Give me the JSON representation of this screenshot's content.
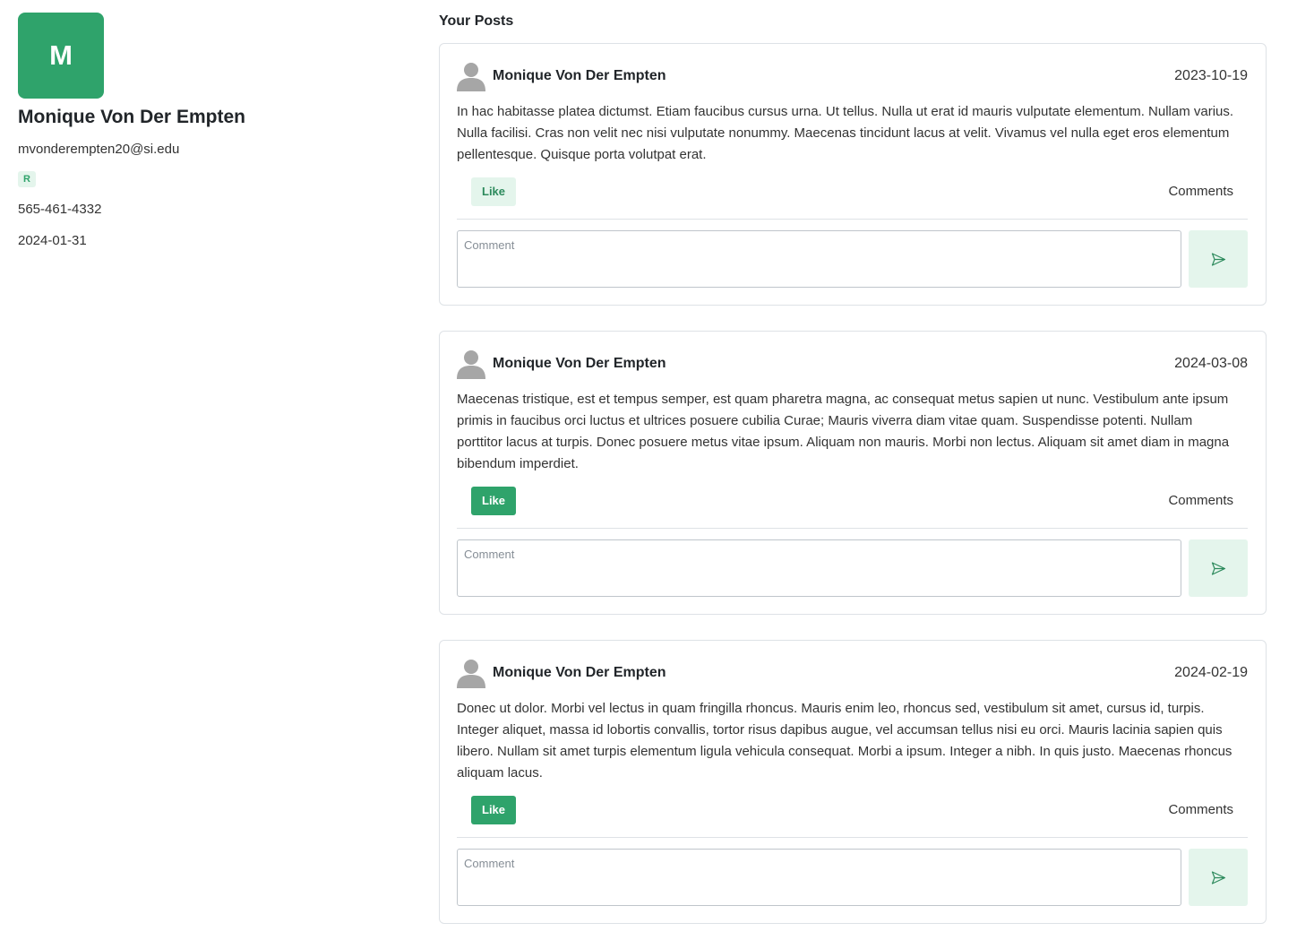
{
  "profile": {
    "avatar_letter": "M",
    "name": "Monique Von Der Empten",
    "email": "mvonderempten20@si.edu",
    "role_badge": "R",
    "phone": "565-461-4332",
    "date": "2024-01-31"
  },
  "posts_section": {
    "title": "Your Posts"
  },
  "posts": [
    {
      "author": "Monique Von Der Empten",
      "date": "2023-10-19",
      "body": "In hac habitasse platea dictumst. Etiam faucibus cursus urna. Ut tellus. Nulla ut erat id mauris vulputate elementum. Nullam varius. Nulla facilisi. Cras non velit nec nisi vulputate nonummy. Maecenas tincidunt lacus at velit. Vivamus vel nulla eget eros elementum pellentesque. Quisque porta volutpat erat.",
      "like_label": "Like",
      "liked": false,
      "comments_label": "Comments",
      "comment_placeholder": "Comment"
    },
    {
      "author": "Monique Von Der Empten",
      "date": "2024-03-08",
      "body": "Maecenas tristique, est et tempus semper, est quam pharetra magna, ac consequat metus sapien ut nunc. Vestibulum ante ipsum primis in faucibus orci luctus et ultrices posuere cubilia Curae; Mauris viverra diam vitae quam. Suspendisse potenti. Nullam porttitor lacus at turpis. Donec posuere metus vitae ipsum. Aliquam non mauris. Morbi non lectus. Aliquam sit amet diam in magna bibendum imperdiet.",
      "like_label": "Like",
      "liked": true,
      "comments_label": "Comments",
      "comment_placeholder": "Comment"
    },
    {
      "author": "Monique Von Der Empten",
      "date": "2024-02-19",
      "body": "Donec ut dolor. Morbi vel lectus in quam fringilla rhoncus. Mauris enim leo, rhoncus sed, vestibulum sit amet, cursus id, turpis. Integer aliquet, massa id lobortis convallis, tortor risus dapibus augue, vel accumsan tellus nisi eu orci. Mauris lacinia sapien quis libero. Nullam sit amet turpis elementum ligula vehicula consequat. Morbi a ipsum. Integer a nibh. In quis justo. Maecenas rhoncus aliquam lacus.",
      "like_label": "Like",
      "liked": true,
      "comments_label": "Comments",
      "comment_placeholder": "Comment"
    }
  ],
  "icons": {
    "author": "user-silhouette-icon",
    "send": "send-icon"
  },
  "colors": {
    "accent": "#2fa36b",
    "accent_light": "#e4f5ec"
  }
}
